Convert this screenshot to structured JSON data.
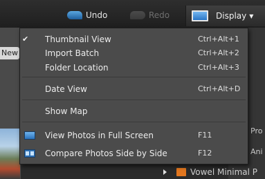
{
  "toolbar": {
    "undo_label": "Undo",
    "redo_label": "Redo",
    "display_label": "Display"
  },
  "background": {
    "new_tab_label": "New",
    "right_text_1": "Pro",
    "right_text_2": "Ani",
    "folder_label": "Vowel Minimal P"
  },
  "menu": {
    "items": [
      {
        "label": "Thumbnail View",
        "shortcut": "Ctrl+Alt+1",
        "checked": true
      },
      {
        "label": "Import Batch",
        "shortcut": "Ctrl+Alt+2"
      },
      {
        "label": "Folder Location",
        "shortcut": "Ctrl+Alt+3"
      },
      {
        "label": "Date View",
        "shortcut": "Ctrl+Alt+D"
      },
      {
        "label": "Show Map",
        "shortcut": ""
      },
      {
        "label": "View Photos in Full Screen",
        "shortcut": "F11"
      },
      {
        "label": "Compare Photos Side by Side",
        "shortcut": "F12"
      }
    ],
    "check_glyph": "✔"
  }
}
